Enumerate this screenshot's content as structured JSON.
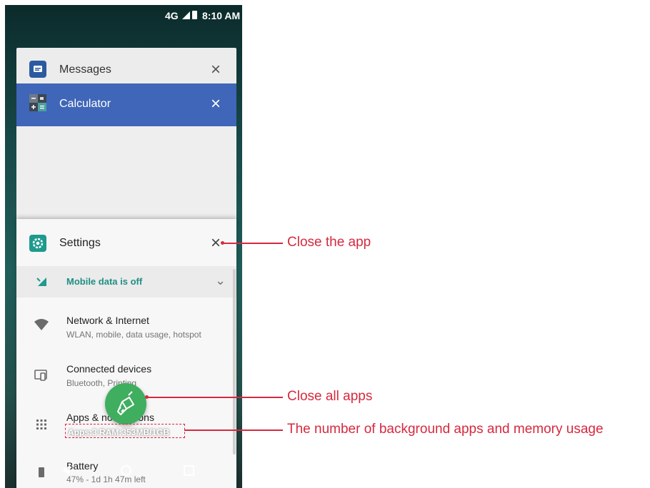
{
  "status_bar": {
    "network": "4G",
    "time": "8:10 AM",
    "icons": [
      "signal-icon",
      "battery-icon"
    ]
  },
  "recent_apps": {
    "messages": {
      "title": "Messages",
      "icon": "messages-icon",
      "close": "×",
      "color": "#2c5aa0"
    },
    "calculator": {
      "title": "Calculator",
      "icon": "calculator-icon",
      "close": "×",
      "color": "#3f66b8"
    },
    "settings": {
      "title": "Settings",
      "icon": "gear-icon",
      "close": "×",
      "color": "#1e9a8e",
      "banner": {
        "text": "Mobile data is off",
        "icon": "mobile-data-off-icon",
        "chevron": "⌄"
      },
      "items": [
        {
          "title": "Network & Internet",
          "subtitle": "WLAN, mobile, data usage, hotspot",
          "icon": "wifi-icon"
        },
        {
          "title": "Connected devices",
          "subtitle": "Bluetooth, Printing",
          "icon": "devices-icon"
        },
        {
          "title": "Apps & notifications",
          "subtitle": "",
          "icon": "apps-grid-icon"
        },
        {
          "title": "Battery",
          "subtitle": "47% - 1d 1h 47m left",
          "icon": "battery-icon"
        }
      ]
    }
  },
  "clear_all": {
    "icon": "broom-icon",
    "color": "#3fae5f"
  },
  "memory_info": "Apps:3 RAM:353MB/1GB",
  "nav": {
    "back": "back-icon",
    "home": "home-icon",
    "recent": "recent-apps-icon"
  },
  "callouts": {
    "close_app": "Close the app",
    "close_all": "Close all apps",
    "memory": "The number of background apps and memory usage"
  },
  "accent_color": "#d6293f"
}
